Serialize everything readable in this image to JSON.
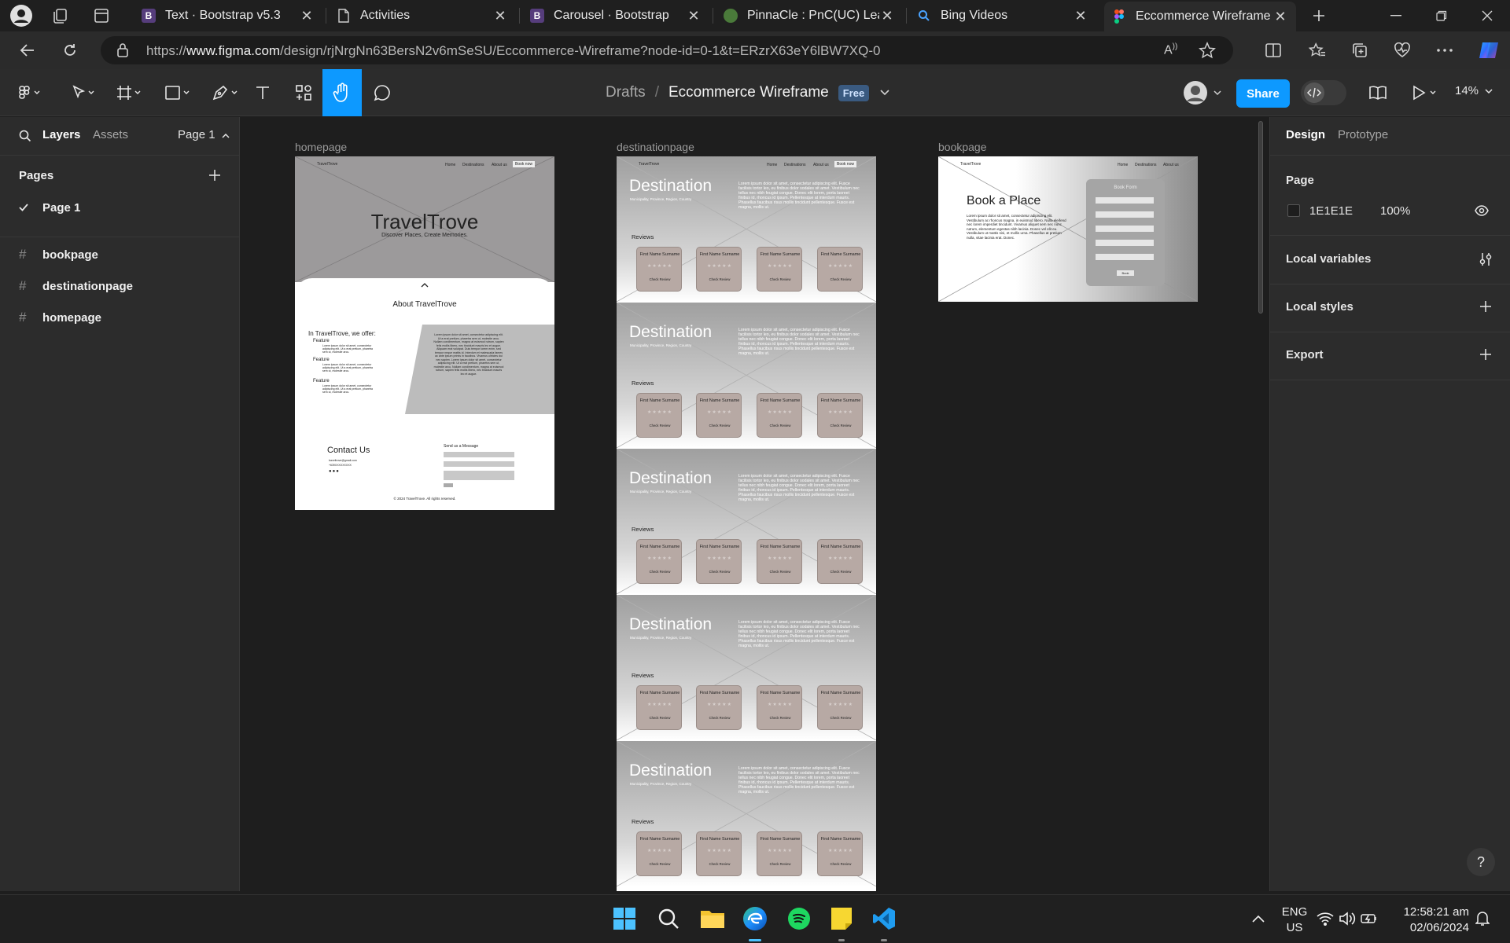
{
  "browser": {
    "tabs": [
      {
        "label": "Text · Bootstrap v5.3",
        "favicon": "B",
        "fav_color": "#563d7c"
      },
      {
        "label": "Activities",
        "favicon": "",
        "fav_color": ""
      },
      {
        "label": "Carousel · Bootstrap",
        "favicon": "B",
        "fav_color": "#563d7c"
      },
      {
        "label": "PinnaCle : PnC(UC) Learn",
        "favicon": "",
        "fav_color": "#4a7a3a"
      },
      {
        "label": "Bing Videos",
        "favicon": "",
        "fav_color": ""
      },
      {
        "label": "Eccommerce Wireframe –",
        "favicon": "",
        "fav_color": ""
      }
    ],
    "url_prefix": "https://",
    "url_domain": "www.figma.com",
    "url_path": "/design/rjNrgNn63BersN2v6mSeSU/Eccommerce-Wireframe?node-id=0-1&t=ERzrX63eY6lBW7XQ-0"
  },
  "figma": {
    "breadcrumb_drafts": "Drafts",
    "breadcrumb_sep": "/",
    "file_name": "Eccommerce Wireframe",
    "plan_badge": "Free",
    "share_label": "Share",
    "zoom": "14%",
    "accent": "#0d99ff"
  },
  "left_panel": {
    "tab_layers": "Layers",
    "tab_assets": "Assets",
    "page_selector": "Page 1",
    "pages_heading": "Pages",
    "pages": [
      "Page 1"
    ],
    "layers": [
      "bookpage",
      "destinationpage",
      "homepage"
    ]
  },
  "right_panel": {
    "tab_design": "Design",
    "tab_prototype": "Prototype",
    "page_heading": "Page",
    "page_color": "1E1E1E",
    "page_opacity": "100%",
    "local_variables": "Local variables",
    "local_styles": "Local styles",
    "export": "Export",
    "help": "?"
  },
  "canvas": {
    "frames": {
      "homepage": "homepage",
      "destinationpage": "destinationpage",
      "bookpage": "bookpage"
    },
    "home": {
      "brand": "TravelTrove",
      "nav": [
        "Home",
        "Destinations",
        "About us"
      ],
      "nav_cta": "Book now",
      "hero_title": "TravelTrove",
      "hero_sub": "Discover Places, Create Memories.",
      "about_title": "About TravelTrove",
      "offer_title": "In TravelTrove, we offer:",
      "features": [
        "Feature",
        "Feature",
        "Feature"
      ],
      "feature_text": "Lorem ipsum dolor sit amet, consectetur adipiscing elit. Ut a erat pretium, pharetra sem ut, molestie arcu.",
      "about_text": "Lorem ipsum dolor sit amet, consectetur adipiscing elit. Ut a erat pretium, pharetra sem ut, molestie arcu. Nullam condimentum, magna at euismod rutrum, sapien felis mollis libero, nec tincidunt mauris leo et augue. Aliquam erat volutpat. Duis tempor lorem enim, sed tempor neque mattis id. Interdum et malesuada fames ac ante ipsum primis in faucibus. Vivamus ultricies dui nec sapien. Lorem ipsum dolor sit amet, consectetur adipiscing elit. Ut a erat pretium, pharetra sem ut, molestie arcu. Nullam condimentum, magna at euismod rutrum, sapien felis mollis libero, nec tincidunt mauris leo et augue.",
      "contact_title": "Contact Us",
      "contact_email": "traveltrove@gmail.com",
      "contact_phone": "+639XXXXXXXXX",
      "message_title": "Send us a Message",
      "footer": "© 2024 TravelTrove. All rights reserved."
    },
    "destination": {
      "brand": "TravelTrove",
      "nav": [
        "Home",
        "Destinations",
        "About us"
      ],
      "nav_cta": "Book now",
      "title": "Destination",
      "subtitle": "Municipality, Province, Region, Country",
      "body": "Lorem ipsum dolor sit amet, consectetur adipiscing elit. Fusce facilisis tortor leo, eu finibus dolor sodales sit amet. Vestibulum nec tellus nec nibh feugiat congue. Donec elit lorem, porta laoreet finibus id, rhoncus id ipsum. Pellentesque at interdum mauris. Phasellus faucibus risus mollis tincidunt pellentesque. Fusce est magna, mollis ut.",
      "reviews_label": "Reviews",
      "card_name": "First Name Surname",
      "card_stars": "★★★★★",
      "card_link": "Check Review"
    },
    "book": {
      "brand": "TravelTrove",
      "nav": [
        "Home",
        "Destinations",
        "About us"
      ],
      "title": "Book a Place",
      "body": "Lorem ipsum dolor sit amet, consectetur adipiscing elit. Vestibulum ac rhoncus magna, in euismod libero. Nulla eleifend nec lorem imperdiet tincidunt. Vivamus aliquet sem nec nunc rutrum, elementum egestas nibh lacinia. Donec vel elit eu. Vestibulum ut mattis nisi, et mollis urna. Phasellus at pretium nulla, vitae lacinia erat. Donec.",
      "form_title": "Book Form",
      "form_button": "Book"
    }
  },
  "taskbar": {
    "lang_top": "ENG",
    "lang_bottom": "US",
    "time": "12:58:21 am",
    "date": "02/06/2024"
  }
}
